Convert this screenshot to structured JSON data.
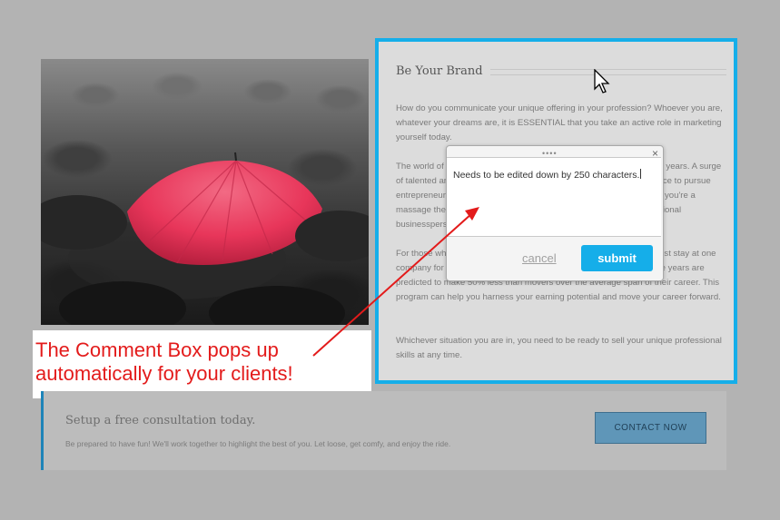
{
  "article": {
    "title": "Be Your Brand",
    "p1": "How do you communicate your unique offering in your profession? Whoever you are, whatever your dreams are, it is ESSENTIAL that you take an active role in marketing yourself today.",
    "p2": "The world of work is changing. The average job tenure is now just 4.5 years. A surge of talented and experienced people are leaving the traditional workforce to pursue entrepreneurial careers. You need to stand out from the rest, whether you're a massage therapist or a small business owner, professional or professional businessperson.",
    "p3": "For those who are already employed, the news is mixed: although most stay at one company for more than two years, those who move every two or more years are predicted to make 50% less than movers over the average span of their career. This program can help you harness your earning potential and move your career forward.",
    "p4": "Whichever situation you are in, you need to be ready to sell your unique professional skills at any time."
  },
  "comment_box": {
    "drag_handle": "••••",
    "close": "×",
    "text": "Needs to be edited down by 250 characters.",
    "cancel_label": "cancel",
    "submit_label": "submit"
  },
  "annotation": {
    "line1": "The Comment Box pops up",
    "line2": "automatically for your clients!"
  },
  "consultation": {
    "title": "Setup a free consultation today.",
    "text": "Be prepared to have fun! We'll work together to highlight the best of you. Let loose, get comfy, and enjoy the ride.",
    "button_label": "Contact Now"
  },
  "colors": {
    "accent": "#15aee9",
    "annotation": "#e31b1b",
    "umbrella": "#e8365a",
    "overlay": "#b3b3b3"
  }
}
